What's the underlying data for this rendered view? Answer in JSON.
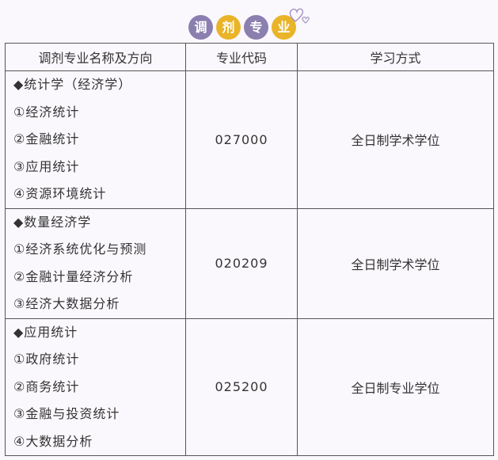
{
  "header": {
    "badges": [
      {
        "char": "调",
        "color": "#8a7fae"
      },
      {
        "char": "剂",
        "color": "#e9b429"
      },
      {
        "char": "专",
        "color": "#8a7fae"
      },
      {
        "char": "业",
        "color": "#e9b429"
      }
    ],
    "heart_color": "#9c8fc2"
  },
  "table": {
    "columns": [
      "调剂专业名称及方向",
      "专业代码",
      "学习方式"
    ],
    "rows": [
      {
        "lines": [
          "◆统计学（经济学）",
          "①经济统计",
          "②金融统计",
          "③应用统计",
          "④资源环境统计"
        ],
        "code": "027000",
        "mode": "全日制学术学位"
      },
      {
        "lines": [
          "◆数量经济学",
          "①经济系统优化与预测",
          "②金融计量经济分析",
          "③经济大数据分析"
        ],
        "code": "020209",
        "mode": "全日制学术学位"
      },
      {
        "lines": [
          "◆应用统计",
          "①政府统计",
          "②商务统计",
          "③金融与投资统计",
          "④大数据分析"
        ],
        "code": "025200",
        "mode": "全日制专业学位"
      }
    ]
  }
}
